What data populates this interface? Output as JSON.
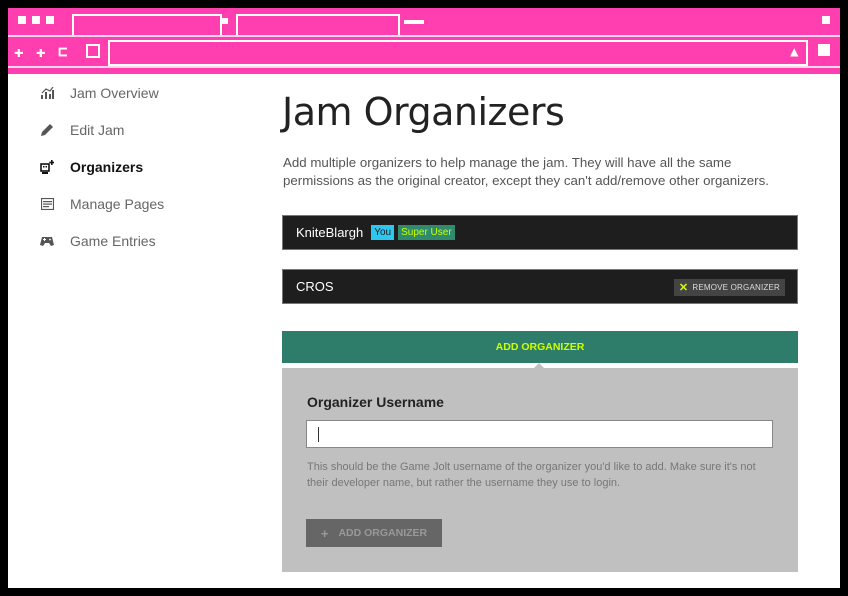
{
  "sidebar": {
    "items": [
      {
        "label": "Jam Overview",
        "icon": "chart-icon",
        "active": false
      },
      {
        "label": "Edit Jam",
        "icon": "pencil-icon",
        "active": false
      },
      {
        "label": "Organizers",
        "icon": "organizers-icon",
        "active": true
      },
      {
        "label": "Manage Pages",
        "icon": "pages-icon",
        "active": false
      },
      {
        "label": "Game Entries",
        "icon": "gamepad-icon",
        "active": false
      }
    ]
  },
  "main": {
    "title": "Jam Organizers",
    "description": "Add multiple organizers to help manage the jam. They will have all the same permissions as the original creator, except they can't add/remove other organizers.",
    "organizers": [
      {
        "name": "KniteBlargh",
        "tags": [
          "You",
          "Super User"
        ]
      },
      {
        "name": "CROS",
        "remove_label": "REMOVE ORGANIZER"
      }
    ],
    "add_toggle_label": "ADD ORGANIZER",
    "form": {
      "label": "Organizer Username",
      "value": "",
      "help": "This should be the Game Jolt username of the organizer you'd like to add. Make sure it's not their developer name, but rather the username they use to login.",
      "submit_label": "ADD ORGANIZER"
    }
  },
  "colors": {
    "chrome": "#ff3fb0",
    "accent": "#2e7d6b",
    "highlight": "#ccff00",
    "you_tag": "#2ec7f0"
  }
}
